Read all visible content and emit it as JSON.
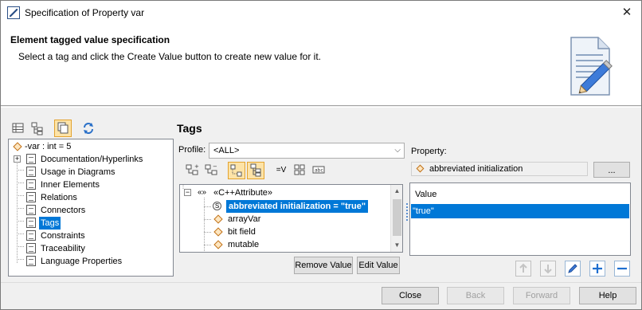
{
  "window": {
    "title": "Specification of Property var",
    "close_glyph": "✕"
  },
  "header": {
    "title": "Element tagged value specification",
    "subtitle": "Select a tag and click the Create Value button to create new value for it."
  },
  "tree": {
    "root": "-var : int = 5",
    "items": [
      "Documentation/Hyperlinks",
      "Usage in Diagrams",
      "Inner Elements",
      "Relations",
      "Connectors",
      "Tags",
      "Constraints",
      "Traceability",
      "Language Properties"
    ],
    "selected": "Tags"
  },
  "tags": {
    "title": "Tags",
    "profile_label": "Profile:",
    "profile_value": "<ALL>",
    "group": "«C++Attribute»",
    "group_prefix": "«»",
    "items": [
      "abbreviated initialization = \"true\"",
      "arrayVar",
      "bit field",
      "mutable"
    ],
    "selected_index": 0,
    "remove_value": "Remove Value",
    "edit_value": "Edit Value",
    "equals_v": "=V"
  },
  "property": {
    "label": "Property:",
    "value": "abbreviated initialization",
    "browse": "..."
  },
  "values": {
    "header": "Value",
    "rows": [
      "\"true\""
    ]
  },
  "footer": {
    "close": "Close",
    "back": "Back",
    "forward": "Forward",
    "help": "Help"
  },
  "icons": {
    "app": "magicdraw-app-icon",
    "doc": "document-pencil-icon"
  },
  "colors": {
    "selection": "#0078d7",
    "active_toolbar": "#fde3a7",
    "tag_diamond": "#c07017"
  }
}
